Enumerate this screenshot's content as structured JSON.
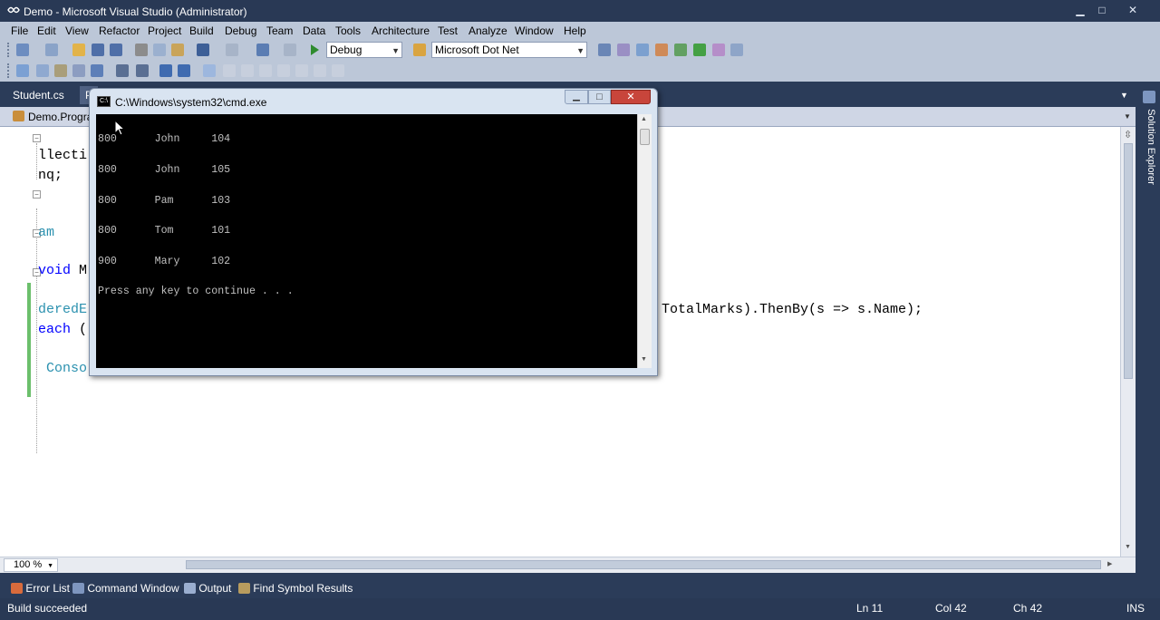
{
  "window": {
    "title": "Demo - Microsoft Visual Studio (Administrator)",
    "controls": {
      "minimize": "▁",
      "maximize": "□",
      "close": "✕"
    }
  },
  "menu": [
    "File",
    "Edit",
    "View",
    "Refactor",
    "Project",
    "Build",
    "Debug",
    "Team",
    "Data",
    "Tools",
    "Architecture",
    "Test",
    "Analyze",
    "Window",
    "Help"
  ],
  "toolbar": {
    "configuration": "Debug",
    "search_combo": "Microsoft Dot Net"
  },
  "tabs": {
    "active": "Student.cs",
    "partial": "P"
  },
  "navbar": {
    "type_combo": "Demo.Progra"
  },
  "editor": {
    "lines": [
      {
        "text": "llecti",
        "kw": ""
      },
      {
        "text": "nq;",
        "kw": ""
      },
      {
        "text": "am",
        "kw": ""
      },
      {
        "text": " M",
        "kw": "void"
      },
      {
        "text": "deredE",
        "kw": ""
      },
      {
        "text": " (",
        "kw": "each"
      },
      {
        "text": "Conso",
        "kw": ""
      }
    ],
    "right_fragment": "TotalMarks).ThenBy(s => s.Name);",
    "zoom": "100 %"
  },
  "cmd": {
    "title": "C:\\Windows\\system32\\cmd.exe",
    "output": [
      "800      John     104",
      "800      John     105",
      "800      Pam      103",
      "800      Tom      101",
      "900      Mary     102",
      "Press any key to continue . . ."
    ]
  },
  "side_panel": {
    "label": "Solution Explorer"
  },
  "bottom_tabs": [
    "Error List",
    "Command Window",
    "Output",
    "Find Symbol Results"
  ],
  "status": {
    "message": "Build succeeded",
    "line": "Ln 11",
    "col": "Col 42",
    "ch": "Ch 42",
    "mode": "INS"
  }
}
